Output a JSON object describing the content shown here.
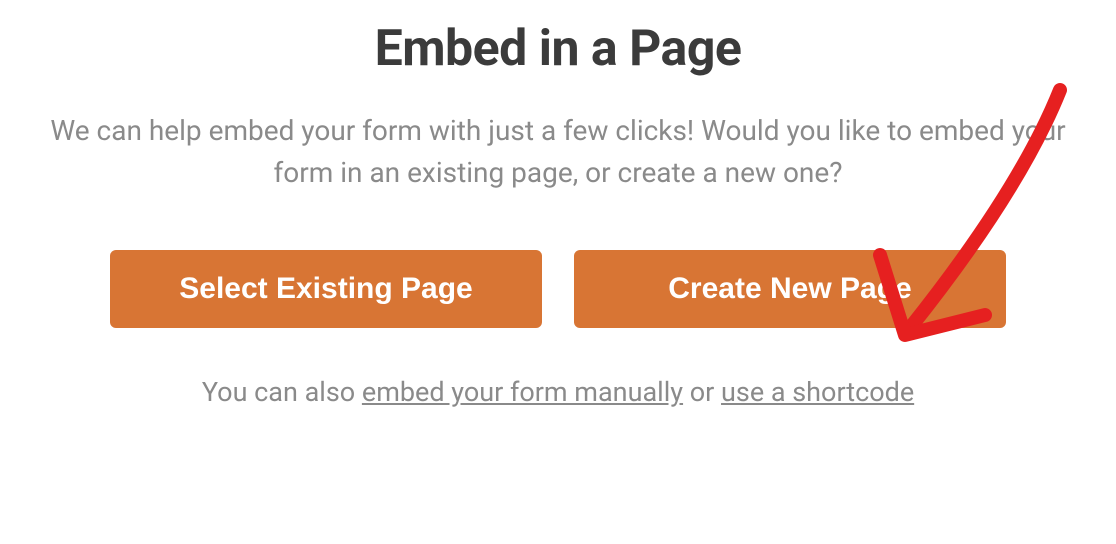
{
  "title": "Embed in a Page",
  "description": "We can help embed your form with just a few clicks! Would you like to embed your form in an existing page, or create a new one?",
  "buttons": {
    "select_existing": "Select Existing Page",
    "create_new": "Create New Page"
  },
  "footer": {
    "prefix": "You can also ",
    "link_manual": "embed your form manually",
    "middle": " or ",
    "link_shortcode": "use a shortcode"
  },
  "colors": {
    "button_bg": "#d87534",
    "text_dark": "#3b3b3b",
    "text_muted": "#8a8a8a",
    "annotation": "#e62020"
  }
}
